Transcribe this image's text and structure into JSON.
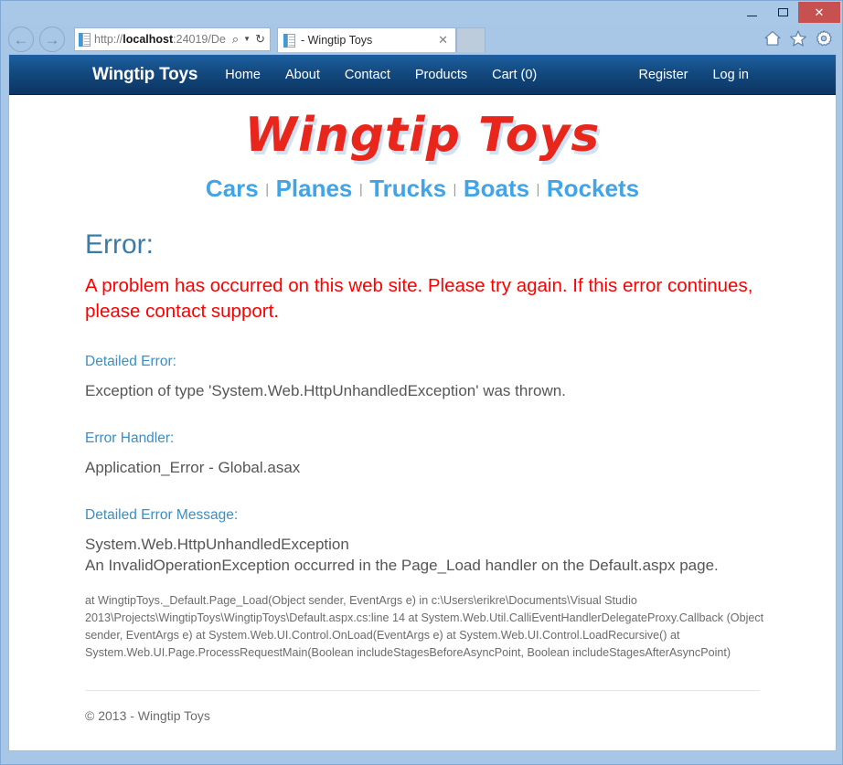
{
  "window": {
    "minimize_label": "–",
    "maximize_label": "□",
    "close_label": "✕"
  },
  "browser": {
    "back_label": "←",
    "forward_label": "→",
    "url_prefix": "http://",
    "url_host": "localhost",
    "url_suffix": ":24019/De",
    "search_icon": "⌕",
    "caret_icon": "▼",
    "refresh_icon": "↻",
    "tab_title": "- Wingtip Toys",
    "tab_close_label": "✕"
  },
  "sitenav": {
    "brand": "Wingtip Toys",
    "links": [
      {
        "label": "Home"
      },
      {
        "label": "About"
      },
      {
        "label": "Contact"
      },
      {
        "label": "Products"
      },
      {
        "label": "Cart (0)"
      }
    ],
    "account_links": [
      {
        "label": "Register"
      },
      {
        "label": "Log in"
      }
    ]
  },
  "page": {
    "logo": "Wingtip Toys",
    "categories": [
      {
        "label": "Cars"
      },
      {
        "label": "Planes"
      },
      {
        "label": "Trucks"
      },
      {
        "label": "Boats"
      },
      {
        "label": "Rockets"
      }
    ],
    "category_separator": "|",
    "error_heading": "Error:",
    "error_message": "A problem has occurred on this web site. Please try again. If this error continues, please contact support.",
    "sections": [
      {
        "label": "Detailed Error:",
        "body": "Exception of type 'System.Web.HttpUnhandledException' was thrown."
      },
      {
        "label": "Error Handler:",
        "body": "Application_Error - Global.asax"
      },
      {
        "label": "Detailed Error Message:",
        "body": "System.Web.HttpUnhandledException\nAn InvalidOperationException occurred in the Page_Load handler on the Default.aspx page."
      }
    ],
    "stack_trace": "at WingtipToys._Default.Page_Load(Object sender, EventArgs e) in c:\\Users\\erikre\\Documents\\Visual Studio 2013\\Projects\\WingtipToys\\WingtipToys\\Default.aspx.cs:line 14 at System.Web.Util.CalliEventHandlerDelegateProxy.Callback (Object sender, EventArgs e) at System.Web.UI.Control.OnLoad(EventArgs e) at System.Web.UI.Control.LoadRecursive() at System.Web.UI.Page.ProcessRequestMain(Boolean includeStagesBeforeAsyncPoint, Boolean includeStagesAfterAsyncPoint)",
    "footer": "© 2013 - Wingtip Toys"
  },
  "colors": {
    "nav_blue": "#13497e",
    "error_red": "#fe0000",
    "link_blue": "#41a4e6",
    "heading_blue": "#3a7ca8",
    "logo_red": "#e8261c"
  }
}
